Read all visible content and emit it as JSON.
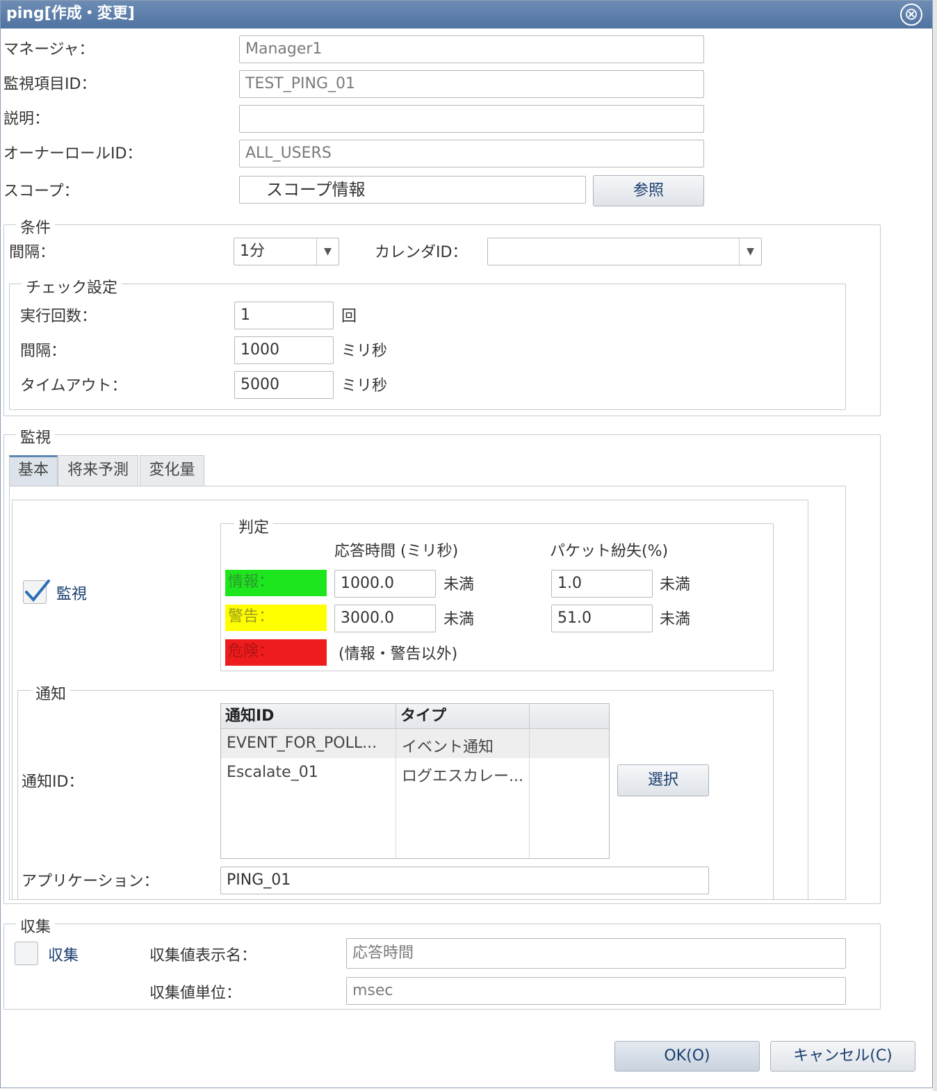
{
  "window": {
    "title": "ping[作成・変更]",
    "close_icon": "⊗"
  },
  "form": {
    "manager_label": "マネージャ：",
    "manager_value": "Manager1",
    "monitor_id_label": "監視項目ID：",
    "monitor_id_value": "TEST_PING_01",
    "description_label": "説明：",
    "description_value": "",
    "owner_role_label": "オーナーロールID：",
    "owner_role_value": "ALL_USERS",
    "scope_label": "スコープ：",
    "scope_value": "スコープ情報",
    "scope_button": "参照"
  },
  "conditions": {
    "title": "条件",
    "interval_label": "間隔：",
    "interval_value": "1分",
    "calendar_label": "カレンダID：",
    "calendar_value": "",
    "check": {
      "title": "チェック設定",
      "run_count_label": "実行回数：",
      "run_count_value": "1",
      "run_count_unit": "回",
      "interval_label": "間隔：",
      "interval_value": "1000",
      "interval_unit": "ミリ秒",
      "timeout_label": "タイムアウト：",
      "timeout_value": "5000",
      "timeout_unit": "ミリ秒"
    }
  },
  "monitor": {
    "title": "監視",
    "tabs": [
      {
        "label": "基本",
        "active": true
      },
      {
        "label": "将来予測",
        "active": false
      },
      {
        "label": "変化量",
        "active": false
      }
    ],
    "enabled_label": "監視",
    "enabled": true,
    "judgement": {
      "title": "判定",
      "col_response": "応答時間 (ミリ秒)",
      "col_packet": "パケット紛失(%)",
      "info_label": "情報：",
      "info_color": "#1ee61e",
      "info_response": "1000.0",
      "info_packet": "1.0",
      "warn_label": "警告：",
      "warn_color": "#ffff00",
      "warn_response": "3000.0",
      "warn_packet": "51.0",
      "danger_label": "危険：",
      "danger_color": "#ee1c1c",
      "danger_text": "(情報・警告以外)",
      "less_than": "未満"
    },
    "notify": {
      "title": "通知",
      "id_label": "通知ID：",
      "columns": [
        "通知ID",
        "タイプ"
      ],
      "rows": [
        {
          "id": "EVENT_FOR_POLL...",
          "type": "イベント通知"
        },
        {
          "id": "Escalate_01",
          "type": "ログエスカレー..."
        }
      ],
      "select_button": "選択",
      "app_label": "アプリケーション：",
      "app_value": "PING_01"
    }
  },
  "collect": {
    "title": "収集",
    "enabled_label": "収集",
    "enabled": false,
    "display_name_label": "収集値表示名：",
    "display_name_value": "応答時間",
    "unit_label": "収集値単位：",
    "unit_value": "msec"
  },
  "footer": {
    "ok": "OK(O)",
    "cancel": "キャンセル(C)"
  }
}
